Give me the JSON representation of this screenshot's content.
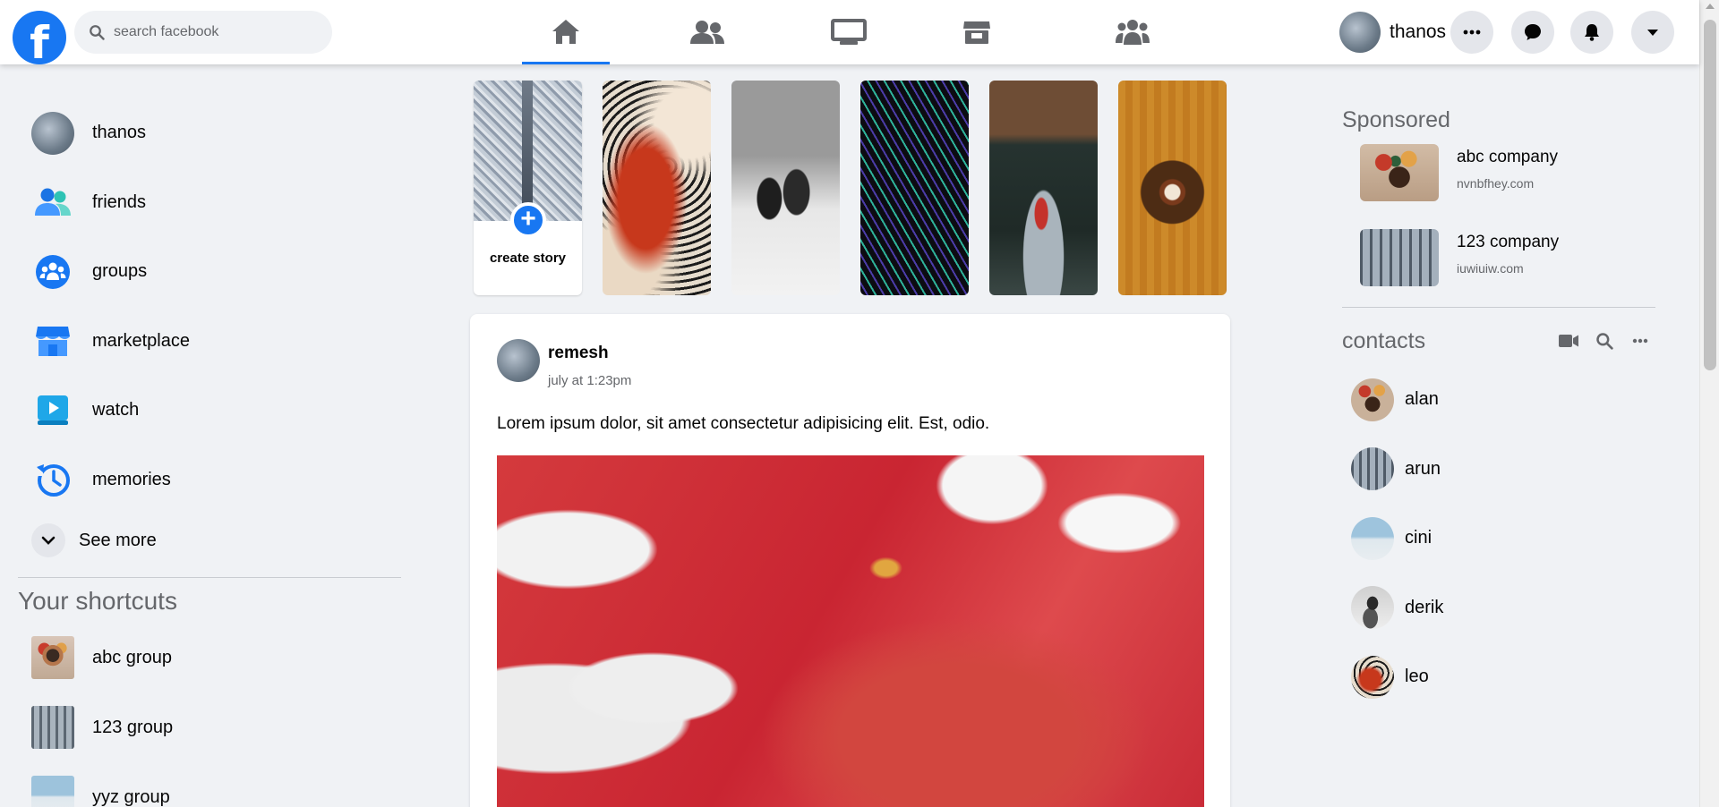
{
  "header": {
    "logo": "f",
    "search": {
      "placeholder": "search facebook"
    },
    "nav": [
      {
        "name": "home-icon",
        "active": true
      },
      {
        "name": "friends-icon",
        "active": false
      },
      {
        "name": "watch-icon",
        "active": false
      },
      {
        "name": "marketplace-icon",
        "active": false
      },
      {
        "name": "groups-icon",
        "active": false
      }
    ],
    "profile_name": "thanos",
    "actions": [
      "more-icon",
      "messenger-icon",
      "notifications-icon",
      "account-menu-icon"
    ]
  },
  "sidebar": {
    "items": [
      {
        "label": "thanos",
        "icon": "profile-avatar"
      },
      {
        "label": "friends",
        "icon": "friends-icon"
      },
      {
        "label": "groups",
        "icon": "groups-icon"
      },
      {
        "label": "marketplace",
        "icon": "marketplace-icon"
      },
      {
        "label": "watch",
        "icon": "watch-icon"
      },
      {
        "label": "memories",
        "icon": "memories-icon"
      }
    ],
    "see_more": "See more",
    "shortcuts_title": "Your shortcuts",
    "shortcuts": [
      {
        "label": "abc group"
      },
      {
        "label": "123 group"
      },
      {
        "label": "yyz group"
      }
    ]
  },
  "stories": {
    "create_label": "create story",
    "create_plus": "+"
  },
  "post": {
    "author": "remesh",
    "time": "july at 1:23pm",
    "text": "Lorem ipsum dolor, sit amet consectetur adipisicing elit. Est, odio."
  },
  "sponsored": {
    "title": "Sponsored",
    "ads": [
      {
        "name": "abc company",
        "url": "nvnbfhey.com"
      },
      {
        "name": "123 company",
        "url": "iuwiuiw.com"
      }
    ]
  },
  "contacts": {
    "title": "contacts",
    "icons": [
      "video-icon",
      "search-icon",
      "more-icon"
    ],
    "list": [
      {
        "name": "alan"
      },
      {
        "name": "arun"
      },
      {
        "name": "cini"
      },
      {
        "name": "derik"
      },
      {
        "name": "leo"
      }
    ]
  },
  "colors": {
    "brand": "#1877f2",
    "background": "#f0f2f5",
    "icon_gray": "#65676b",
    "text": "#050505"
  }
}
